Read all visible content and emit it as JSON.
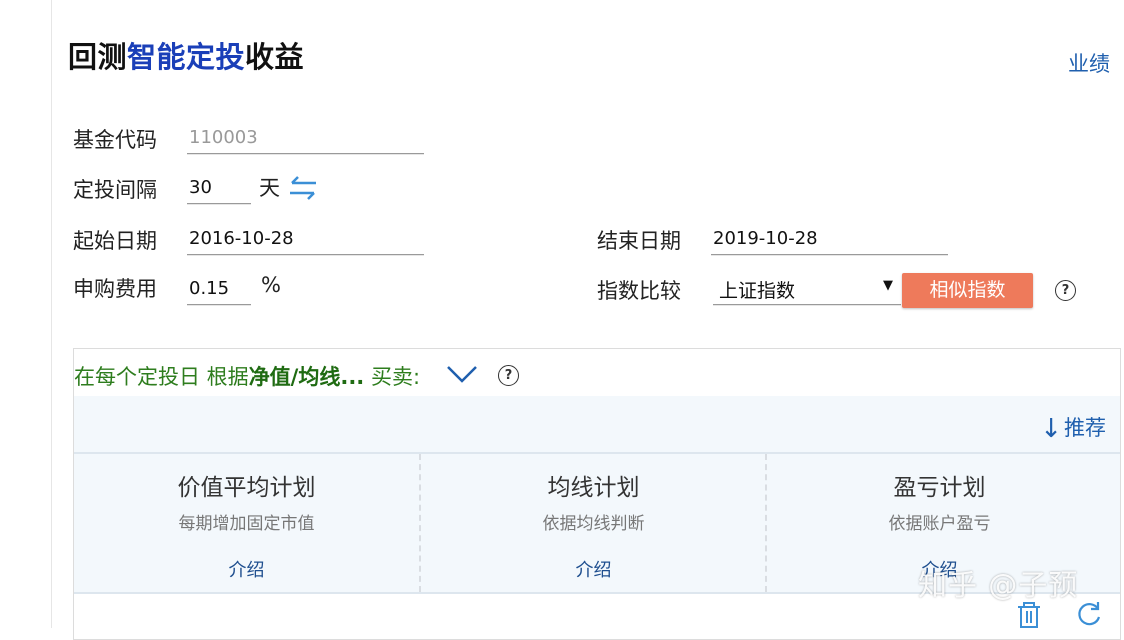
{
  "header": {
    "title_prefix": "回测",
    "title_highlight": "智能定投",
    "title_suffix": "收益",
    "perf_link": "业绩"
  },
  "form": {
    "fund_code_label": "基金代码",
    "fund_code_placeholder": "110003",
    "interval_label": "定投间隔",
    "interval_value": "30",
    "interval_unit": "天",
    "start_label": "起始日期",
    "start_value": "2016-10-28",
    "end_label": "结束日期",
    "end_value": "2019-10-28",
    "fee_label": "申购费用",
    "fee_value": "0.15",
    "fee_unit": "%",
    "index_label": "指数比较",
    "index_selected": "上证指数",
    "similar_button": "相似指数",
    "help_glyph": "?"
  },
  "panel": {
    "rule_prefix": "在每个定投日  根据",
    "rule_bold": "净值/均线...",
    "rule_suffix": " 买卖:",
    "recommend_arrow": "↓",
    "recommend": "推荐",
    "plans": [
      {
        "title": "价值平均计划",
        "subtitle": "每期增加固定市值",
        "link": "介绍"
      },
      {
        "title": "均线计划",
        "subtitle": "依据均线判断",
        "link": "介绍"
      },
      {
        "title": "盈亏计划",
        "subtitle": "依据账户盈亏",
        "link": "介绍"
      }
    ]
  },
  "watermark": "知乎 @子预",
  "colors": {
    "title_highlight": "#1a3fb8",
    "link_blue": "#1f5fae",
    "button_orange": "#ee7a5b",
    "rule_green": "#2e7d1e",
    "panel_bg": "#f3f8fc"
  },
  "icons": [
    "swap-arrows-icon",
    "chevron-down-icon",
    "help-icon",
    "down-arrow-icon",
    "trash-icon",
    "refresh-icon"
  ]
}
